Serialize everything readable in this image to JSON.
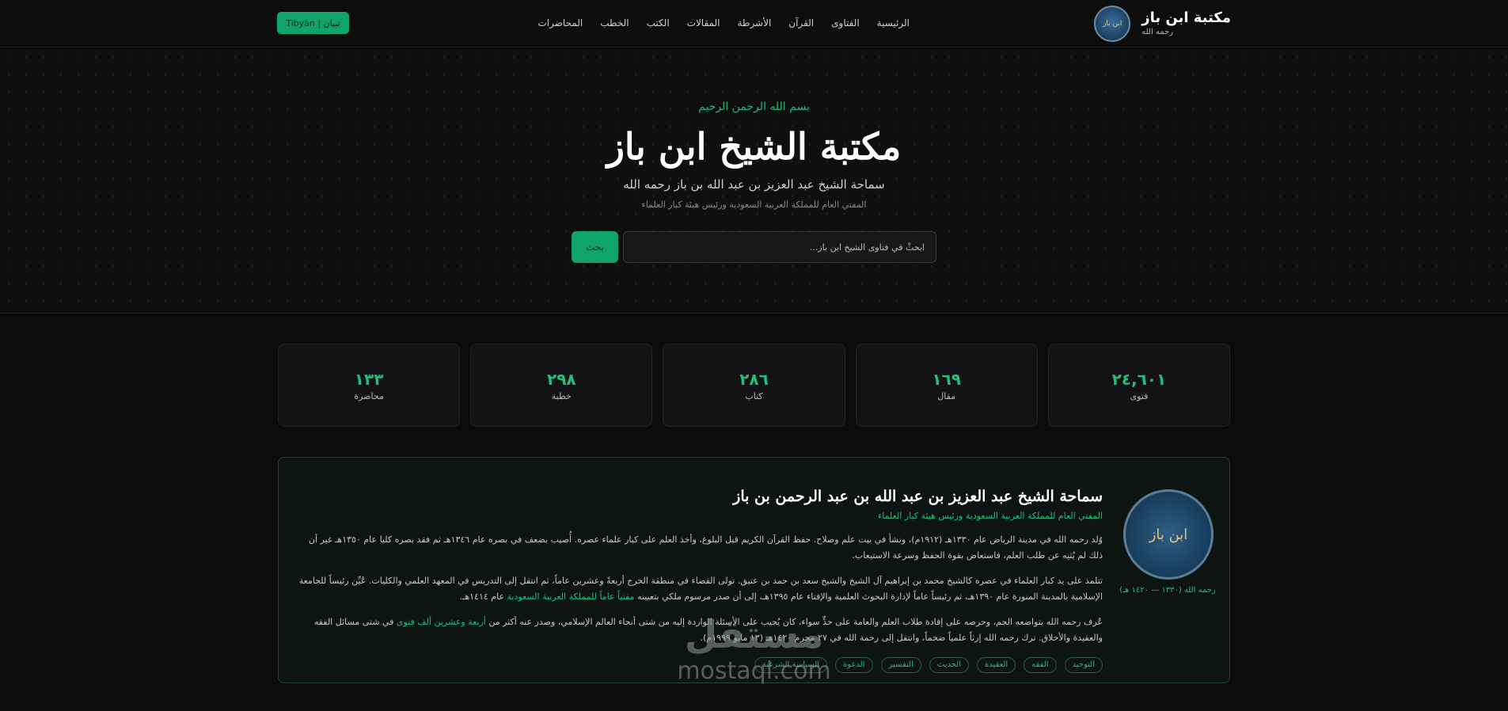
{
  "header": {
    "brand_name": "مكتبة ابن باز",
    "brand_sub": "رحمه الله",
    "seal_glyph": "ابن باز",
    "nav": [
      "الرئيسية",
      "الفتاوى",
      "القرآن",
      "الأشرطة",
      "المقالات",
      "الكتب",
      "الخطب",
      "المحاضرات"
    ],
    "tibyan_label": "تبيان | Tibyān"
  },
  "hero": {
    "basmala": "بسم الله الرحمن الرحيم",
    "title": "مكتبة الشيخ ابن باز",
    "subtitle": "سماحة الشيخ عبد العزيز بن عبد الله بن باز رحمه الله",
    "tagline": "المفتي العام للمملكة العربية السعودية ورئيس هيئة كبار العلماء",
    "search_placeholder": "ابحثْ في فتاوى الشيخ ابن باز...",
    "search_button": "بحث"
  },
  "stats": [
    {
      "value": "٢٤,٦٠١",
      "label": "فتوى"
    },
    {
      "value": "١٦٩",
      "label": "مقال"
    },
    {
      "value": "٢٨٦",
      "label": "كتاب"
    },
    {
      "value": "٢٩٨",
      "label": "خطبة"
    },
    {
      "value": "١٣٣",
      "label": "محاضرة"
    }
  ],
  "bio": {
    "portrait_glyph": "ابن باز",
    "dates": "رحمه الله (١٣٣٠ — ١٤٢٠ هـ)",
    "name": "سماحة الشيخ عبد العزيز بن عبد الله بن عبد الرحمن بن باز",
    "role": "المفتي العام للمملكة العربية السعودية ورئيس هيئة كبار العلماء",
    "p1": "وُلد رحمه الله في مدينة الرياض عام ١٣٣٠هـ (١٩١٢م)، ونشأ في بيت علم وصلاح. حفظ القرآن الكريم قبل البلوغ، وأخذ العلم على كبار علماء عصره. أُصيب بضعف في بصره عام ١٣٤٦هـ ثم فقد بصره كليا عام ١٣٥٠هـ غير أن ذلك لم يُثنِه عن طلب العلم، فاستعاض بقوة الحفظ وسرعة الاستيعاب.",
    "p2_a": "تتلمذ على يد كبار العلماء في عصره كالشيخ محمد بن إبراهيم آل الشيخ والشيخ سعد بن حمد بن عتيق. تولى القضاء في منطقة الخرج أربعةً وعشرين عاماً، ثم انتقل إلى التدريس في المعهد العلمي والكليات. عُيِّن رئيساً للجامعة الإسلامية بالمدينة المنورة عام ١٣٩٠هـ، ثم رئيساً عاماً لإدارة البحوث العلمية والإفتاء عام ١٣٩٥هـ، إلى أن صدر مرسوم ملكي بتعيينه",
    "p2_hl": "مفتياً عاماً للمملكة العربية السعودية",
    "p2_b": "عام ١٤١٤هـ.",
    "p3_a": "عُرف رحمه الله بتواضعه الجم، وحرصه على إفادة طلاب العلم والعامة على حدٍّ سواء، كان يُجيب على الأسئلة الواردة إليه من شتى أنحاء العالم الإسلامي، وصدر عنه أكثر من",
    "p3_hl": "أربعة وعشرين ألف فتوى",
    "p3_b": "في شتى مسائل الفقه والعقيدة والأخلاق. ترك رحمه الله إرثاً علمياً ضخماً، وانتقل إلى رحمة الله في ٢٧ محرم ١٤٢٠هـ (١٣ مايو ١٩٩٩م).",
    "tags": [
      "التوحيد",
      "الفقه",
      "العقيدة",
      "الحديث",
      "التفسير",
      "الدعوة",
      "السياسة الشرعية"
    ]
  },
  "watermark": {
    "ar": "مستقل",
    "en": "mostaql.com"
  },
  "colors": {
    "accent": "#1fbf7a",
    "button": "#10a46a",
    "background": "#0b0b0c"
  }
}
